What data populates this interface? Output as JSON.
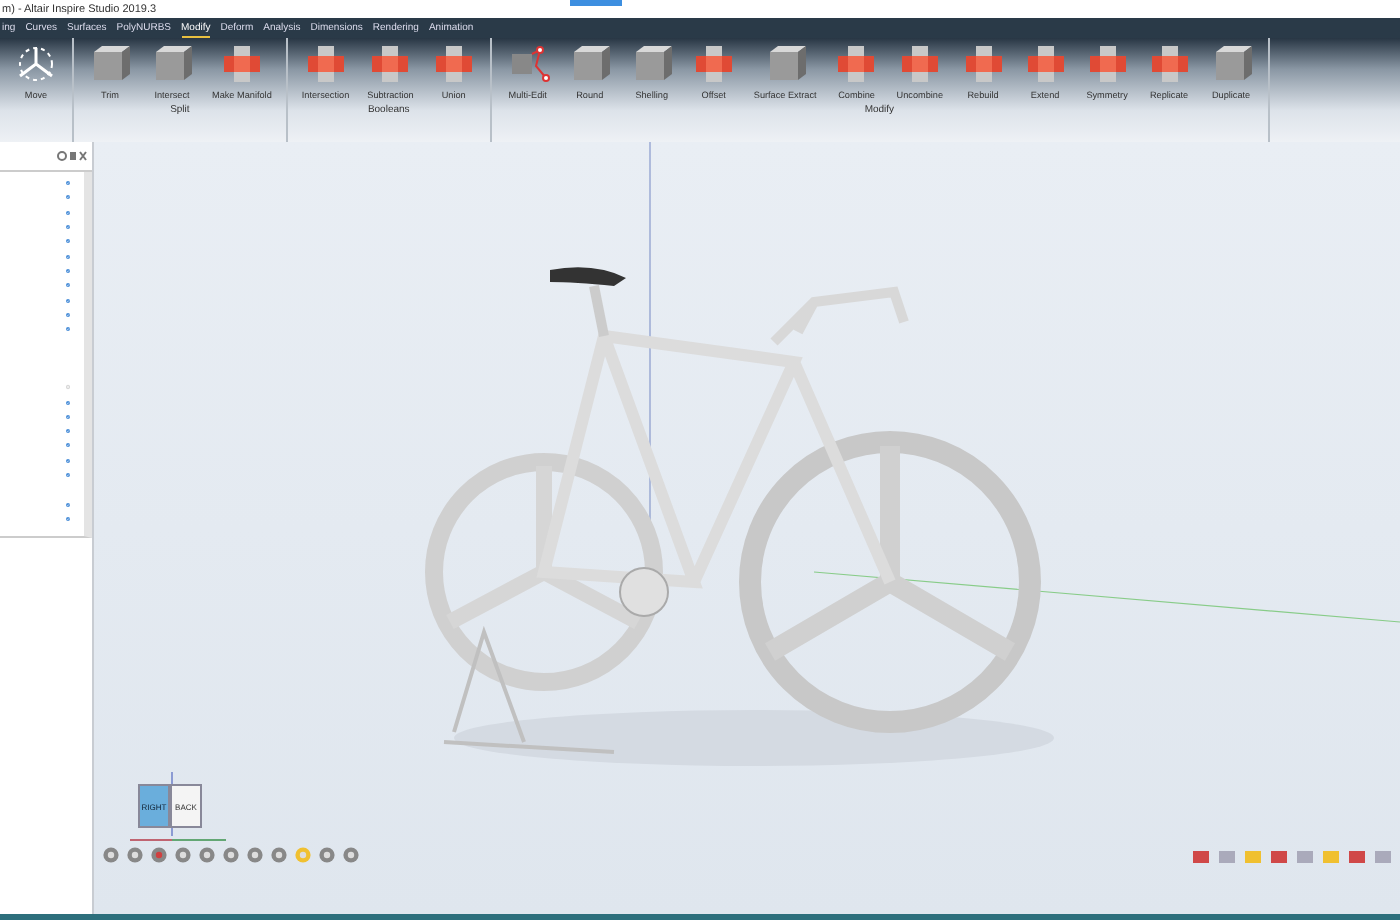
{
  "window": {
    "title": "m) - Altair Inspire Studio 2019.3"
  },
  "menu": [
    {
      "label": "ing",
      "selected": false
    },
    {
      "label": "Curves",
      "selected": false
    },
    {
      "label": "Surfaces",
      "selected": false
    },
    {
      "label": "PolyNURBS",
      "selected": false
    },
    {
      "label": "Modify",
      "selected": true
    },
    {
      "label": "Deform",
      "selected": false
    },
    {
      "label": "Analysis",
      "selected": false
    },
    {
      "label": "Dimensions",
      "selected": false
    },
    {
      "label": "Rendering",
      "selected": false
    },
    {
      "label": "Animation",
      "selected": false
    }
  ],
  "ribbon": [
    {
      "tools": [
        {
          "label": "Move",
          "kind": "move"
        }
      ]
    },
    {
      "label": "Split",
      "tools": [
        {
          "label": "Trim",
          "kind": "solid"
        },
        {
          "label": "Intersect",
          "kind": "solid"
        },
        {
          "label": "Make Manifold",
          "kind": "red"
        }
      ]
    },
    {
      "label": "Booleans",
      "tools": [
        {
          "label": "Intersection",
          "kind": "red"
        },
        {
          "label": "Subtraction",
          "kind": "red"
        },
        {
          "label": "Union",
          "kind": "red"
        }
      ]
    },
    {
      "label": "Modify",
      "tools": [
        {
          "label": "Multi-Edit",
          "kind": "edit"
        },
        {
          "label": "Round",
          "kind": "solid"
        },
        {
          "label": "Shelling",
          "kind": "solid"
        },
        {
          "label": "Offset",
          "kind": "red"
        },
        {
          "label": "Surface Extract",
          "kind": "solid"
        },
        {
          "label": "Combine",
          "kind": "red"
        },
        {
          "label": "Uncombine",
          "kind": "red"
        },
        {
          "label": "Rebuild",
          "kind": "red"
        },
        {
          "label": "Extend",
          "kind": "red"
        },
        {
          "label": "Symmetry",
          "kind": "red"
        },
        {
          "label": "Replicate",
          "kind": "red"
        },
        {
          "label": "Duplicate",
          "kind": "solid"
        }
      ]
    }
  ],
  "viewcube": {
    "faces": [
      "RIGHT",
      "BACK"
    ]
  }
}
